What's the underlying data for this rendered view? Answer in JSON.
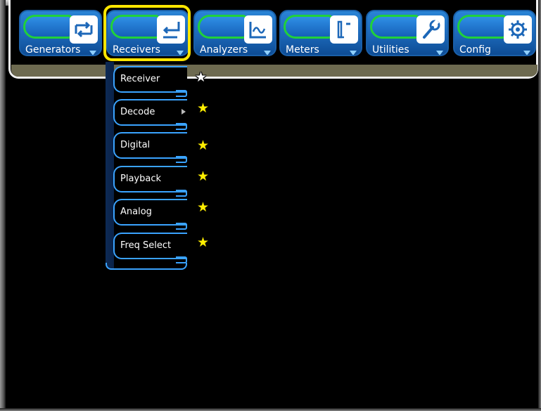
{
  "menu": {
    "items": [
      {
        "label": "Generators",
        "icon": "generators-icon"
      },
      {
        "label": "Receivers",
        "icon": "receivers-icon"
      },
      {
        "label": "Analyzers",
        "icon": "analyzers-icon"
      },
      {
        "label": "Meters",
        "icon": "meters-icon"
      },
      {
        "label": "Utilities",
        "icon": "wrench-icon"
      },
      {
        "label": "Config",
        "icon": "gear-icon"
      }
    ],
    "selected": "Receivers"
  },
  "dropdown": {
    "items": [
      {
        "label": "Receiver",
        "submenu": false
      },
      {
        "label": "Decode",
        "submenu": true
      },
      {
        "label": "Digital",
        "submenu": false
      },
      {
        "label": "Playback",
        "submenu": false
      },
      {
        "label": "Analog",
        "submenu": false
      },
      {
        "label": "Freq Select",
        "submenu": false
      }
    ]
  },
  "colors": {
    "highlight": "#ffe600",
    "accent_blue": "#3aa3ff",
    "button_blue": "#1c67b8",
    "glow_green": "#21d13a"
  }
}
